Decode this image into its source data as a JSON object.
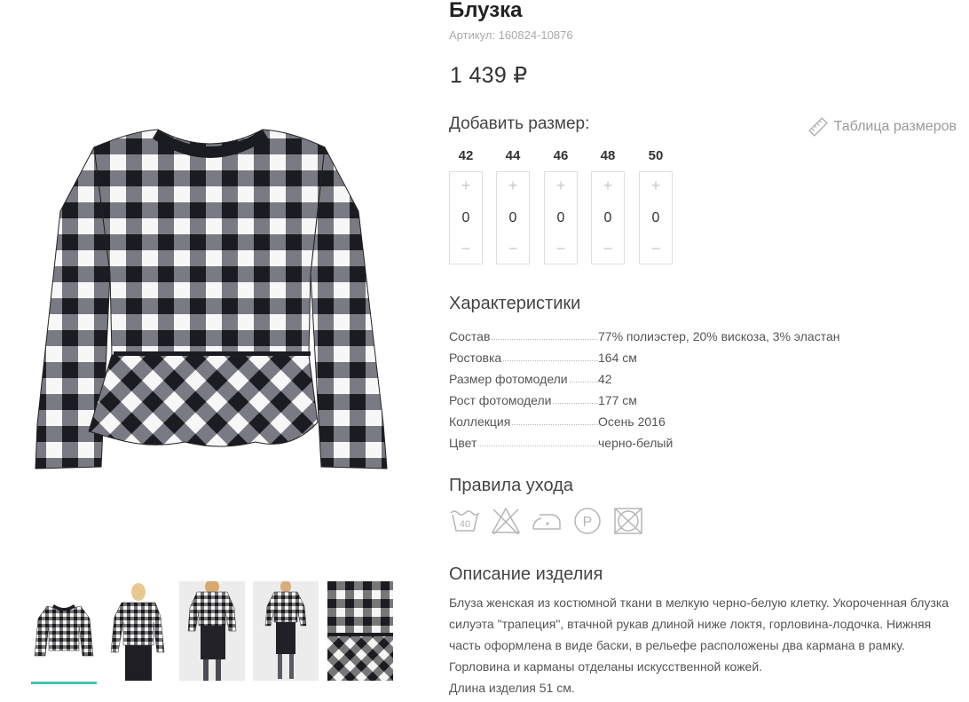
{
  "product": {
    "title": "Блузка",
    "sku": "Артикул: 160824-10876",
    "price": "1 439 ₽"
  },
  "sizes": {
    "heading": "Добавить размер:",
    "table_link": "Таблица размеров",
    "items": [
      {
        "label": "42",
        "qty": "0"
      },
      {
        "label": "44",
        "qty": "0"
      },
      {
        "label": "46",
        "qty": "0"
      },
      {
        "label": "48",
        "qty": "0"
      },
      {
        "label": "50",
        "qty": "0"
      }
    ],
    "plus": "+",
    "minus": "−"
  },
  "characteristics": {
    "heading": "Характеристики",
    "rows": [
      {
        "name": "Состав",
        "value": "77% полиэстер, 20% вискоза, 3% эластан"
      },
      {
        "name": "Ростовка",
        "value": "164 см"
      },
      {
        "name": "Размер фотомодели",
        "value": "42"
      },
      {
        "name": "Рост фотомодели",
        "value": "177 см"
      },
      {
        "name": "Коллекция",
        "value": "Осень 2016"
      },
      {
        "name": "Цвет",
        "value": "черно-белый"
      }
    ]
  },
  "care": {
    "heading": "Правила ухода",
    "icons": [
      "wash-40-icon",
      "no-bleach-icon",
      "iron-low-icon",
      "dry-clean-p-icon",
      "no-tumble-dry-icon"
    ],
    "wash_temp": "40",
    "dry_clean_letter": "P"
  },
  "description": {
    "heading": "Описание изделия",
    "lines": [
      "Блуза женская из костюмной ткани в мелкую черно-белую клетку. Укороченная блузка",
      "силуэта \"трапеция\", втачной рукав длиной ниже локтя, горловина-лодочка. Нижняя",
      "часть оформлена в виде баски, в рельефе расположены два кармана в рамку.",
      "Горловина и карманы отделаны искусственной кожей.",
      "Длина изделия 51 см."
    ]
  },
  "gallery": {
    "thumbnails": [
      "blouse-front",
      "model-front",
      "model-back",
      "model-full",
      "fabric-detail"
    ],
    "active_index": 0
  },
  "colors": {
    "accent": "#3fc3b0",
    "gingham_dark": "#1b1b22",
    "gingham_mid": "#6e6e78",
    "gingham_light": "#f7f7f7",
    "icon_gray": "#b5b5b5"
  }
}
